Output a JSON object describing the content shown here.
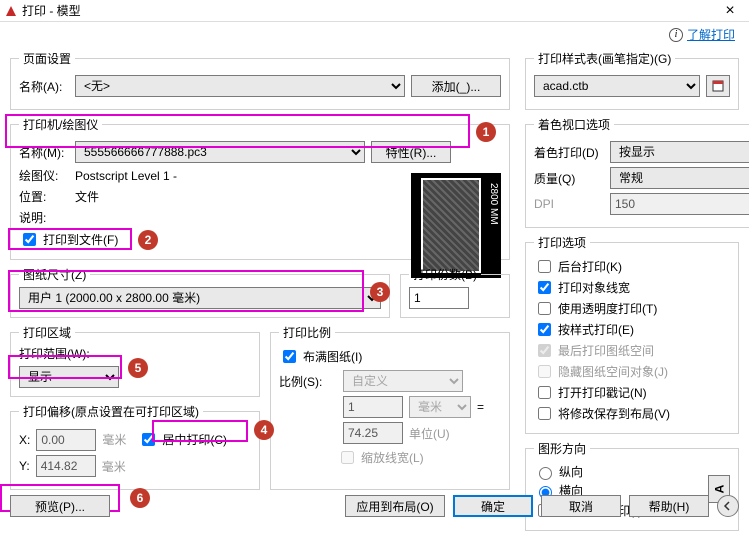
{
  "window": {
    "title": "打印 - 模型"
  },
  "topLink": {
    "text": "了解打印"
  },
  "pageSetup": {
    "legend": "页面设置",
    "nameLabel": "名称(A):",
    "nameValue": "<无>",
    "addBtn": "添加(_)..."
  },
  "printer": {
    "legend": "打印机/绘图仪",
    "nameLabel": "名称(M):",
    "nameValue": "555566666777888.pc3",
    "propsBtn": "特性(R)...",
    "plotterLabel": "绘图仪:",
    "plotterValue": "Postscript Level 1 -",
    "locationLabel": "位置:",
    "locationValue": "文件",
    "descLabel": "说明:",
    "toFile": "打印到文件(F)",
    "dim": "2800 MM"
  },
  "paperSize": {
    "legend": "图纸尺寸(Z)",
    "value": "用户 1 (2000.00 x 2800.00 毫米)"
  },
  "copies": {
    "legend": "打印份数(B)",
    "value": "1"
  },
  "area": {
    "legend": "打印区域",
    "rangeLabel": "打印范围(W):",
    "rangeValue": "显示"
  },
  "scale": {
    "legend": "打印比例",
    "fit": "布满图纸(I)",
    "ratioLabel": "比例(S):",
    "ratioValue": "自定义",
    "num1": "1",
    "unit1": "毫米",
    "num2": "74.25",
    "unit2": "单位(U)",
    "lw": "缩放线宽(L)"
  },
  "offset": {
    "legend": "打印偏移(原点设置在可打印区域)",
    "xLabel": "X:",
    "xValue": "0.00",
    "yLabel": "Y:",
    "yValue": "414.82",
    "mm": "毫米",
    "center": "居中打印(C)"
  },
  "previewBtn": "预览(P)...",
  "styleTable": {
    "legend": "打印样式表(画笔指定)(G)",
    "value": "acad.ctb"
  },
  "viewport": {
    "legend": "着色视口选项",
    "shadeLabel": "着色打印(D)",
    "shadeValue": "按显示",
    "qualityLabel": "质量(Q)",
    "qualityValue": "常规",
    "dpiLabel": "DPI",
    "dpiValue": "150"
  },
  "options": {
    "legend": "打印选项",
    "bg": "后台打印(K)",
    "lw": "打印对象线宽",
    "trans": "使用透明度打印(T)",
    "style": "按样式打印(E)",
    "last": "最后打印图纸空间",
    "hide": "隐藏图纸空间对象(J)",
    "stamp": "打开打印戳记(N)",
    "save": "将修改保存到布局(V)"
  },
  "orient": {
    "legend": "图形方向",
    "portrait": "纵向",
    "landscape": "横向",
    "upside": "上下颠倒打印(-)"
  },
  "bottom": {
    "apply": "应用到布局(O)",
    "ok": "确定",
    "cancel": "取消",
    "help": "帮助(H)"
  },
  "badges": {
    "b1": "1",
    "b2": "2",
    "b3": "3",
    "b4": "4",
    "b5": "5",
    "b6": "6"
  }
}
